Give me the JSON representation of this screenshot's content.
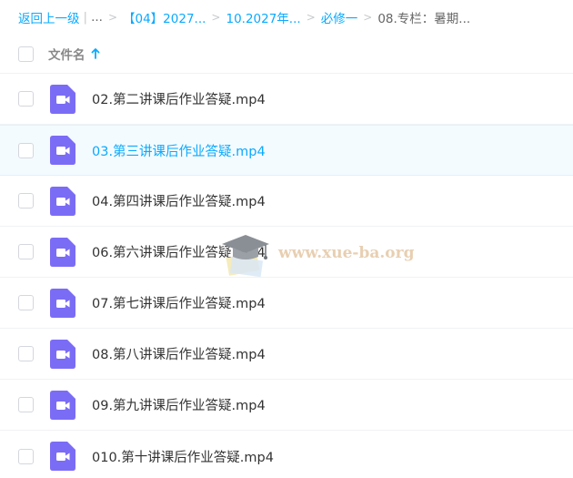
{
  "breadcrumb": {
    "back": "返回上一级",
    "ellipsis": "...",
    "items": [
      "【04】2027...",
      "10.2027年...",
      "必修一"
    ],
    "current": "08.专栏：暑期..."
  },
  "header": {
    "column_label": "文件名"
  },
  "files": [
    "02.第二讲课后作业答疑.mp4",
    "03.第三讲课后作业答疑.mp4",
    "04.第四讲课后作业答疑.mp4",
    "06.第六讲课后作业答疑.mp4",
    "07.第七讲课后作业答疑.mp4",
    "08.第八讲课后作业答疑.mp4",
    "09.第九讲课后作业答疑.mp4",
    "010.第十讲课后作业答疑.mp4"
  ],
  "watermark": {
    "text": "www.xue-ba.org"
  },
  "colors": {
    "accent": "#09aaff",
    "video_icon": "#7b6cf6"
  }
}
